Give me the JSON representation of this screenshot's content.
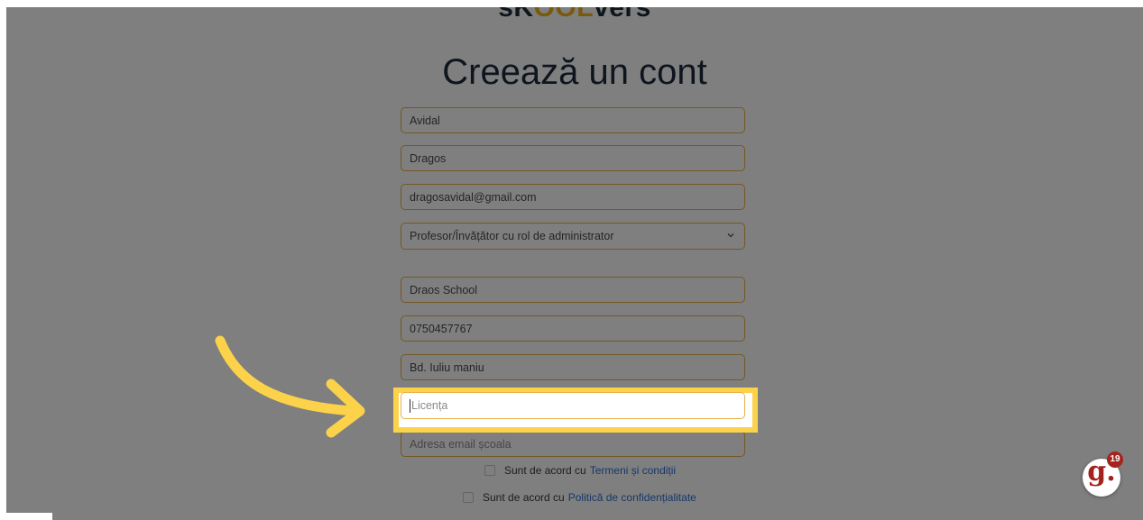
{
  "header": {
    "logo_left": "sK",
    "logo_accent": "OOL",
    "logo_right": "vers",
    "title": "Creează un cont"
  },
  "form": {
    "last_name": "Avidal",
    "first_name": "Dragos",
    "email": "dragosavidal@gmail.com",
    "role_selected": "Profesor/Învățător cu rol de administrator",
    "school_name": "Draos School",
    "phone": "0750457767",
    "address": "Bd. Iuliu maniu",
    "license_placeholder": "Licența",
    "school_email_placeholder": "Adresa email școala"
  },
  "agreements": {
    "terms_prefix": "Sunt de acord cu",
    "terms_link": "Termeni și condiții",
    "privacy_prefix": "Sunt de acord cu",
    "privacy_link": "Politică de confidențialitate"
  },
  "widget": {
    "letter": "g.",
    "count": "19"
  },
  "colors": {
    "highlight": "#fbd24a",
    "field_border": "#e8b04a",
    "link": "#2c6fd1",
    "badge": "#a6231e"
  },
  "icons": [
    "chevron-down-icon",
    "curved-arrow-icon",
    "guidde-icon"
  ]
}
